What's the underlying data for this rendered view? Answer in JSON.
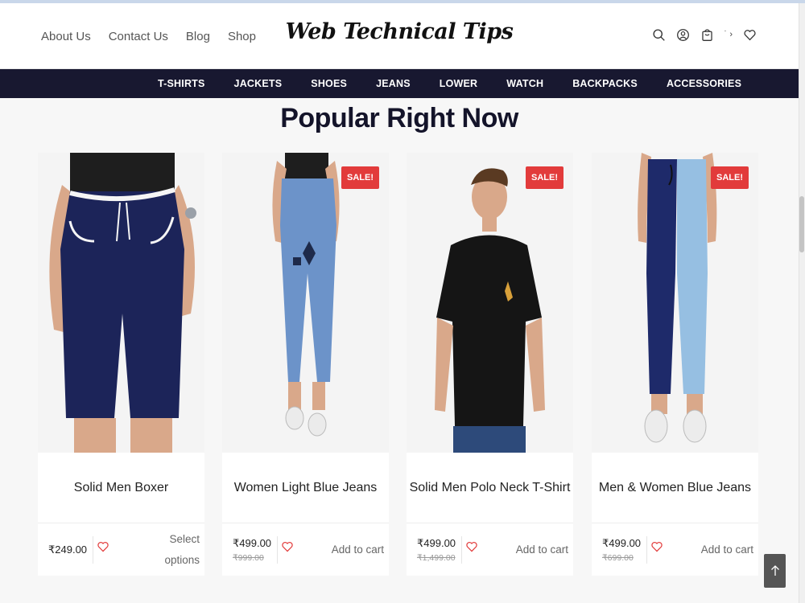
{
  "header": {
    "nav": [
      "About Us",
      "Contact Us",
      "Blog",
      "Shop"
    ],
    "logo": "Web Technical Tips",
    "compare_glyph": "˙ ›"
  },
  "categories": [
    "T-SHIRTS",
    "JACKETS",
    "SHOES",
    "JEANS",
    "LOWER",
    "WATCH",
    "BACKPACKS",
    "ACCESSORIES"
  ],
  "section": {
    "title": "Popular Right Now"
  },
  "products": [
    {
      "name": "Solid Men Boxer",
      "price": "₹249.00",
      "old_price": "",
      "sale": "",
      "action": "Select options"
    },
    {
      "name": "Women Light Blue Jeans",
      "price": "₹499.00",
      "old_price": "₹999.00",
      "sale": "SALE!",
      "action": "Add to cart"
    },
    {
      "name": "Solid Men Polo Neck T-Shirt",
      "price": "₹499.00",
      "old_price": "₹1,499.00",
      "sale": "SALE!",
      "action": "Add to cart"
    },
    {
      "name": "Men & Women Blue Jeans",
      "price": "₹499.00",
      "old_price": "₹699.00",
      "sale": "SALE!",
      "action": "Add to cart"
    }
  ],
  "colors": {
    "nav_bar": "#181830",
    "sale_badge": "#e23b3b",
    "title": "#14142a"
  },
  "icons": [
    "search-icon",
    "account-icon",
    "cart-icon",
    "wishlist-icon",
    "heart-icon",
    "arrow-up-icon"
  ]
}
